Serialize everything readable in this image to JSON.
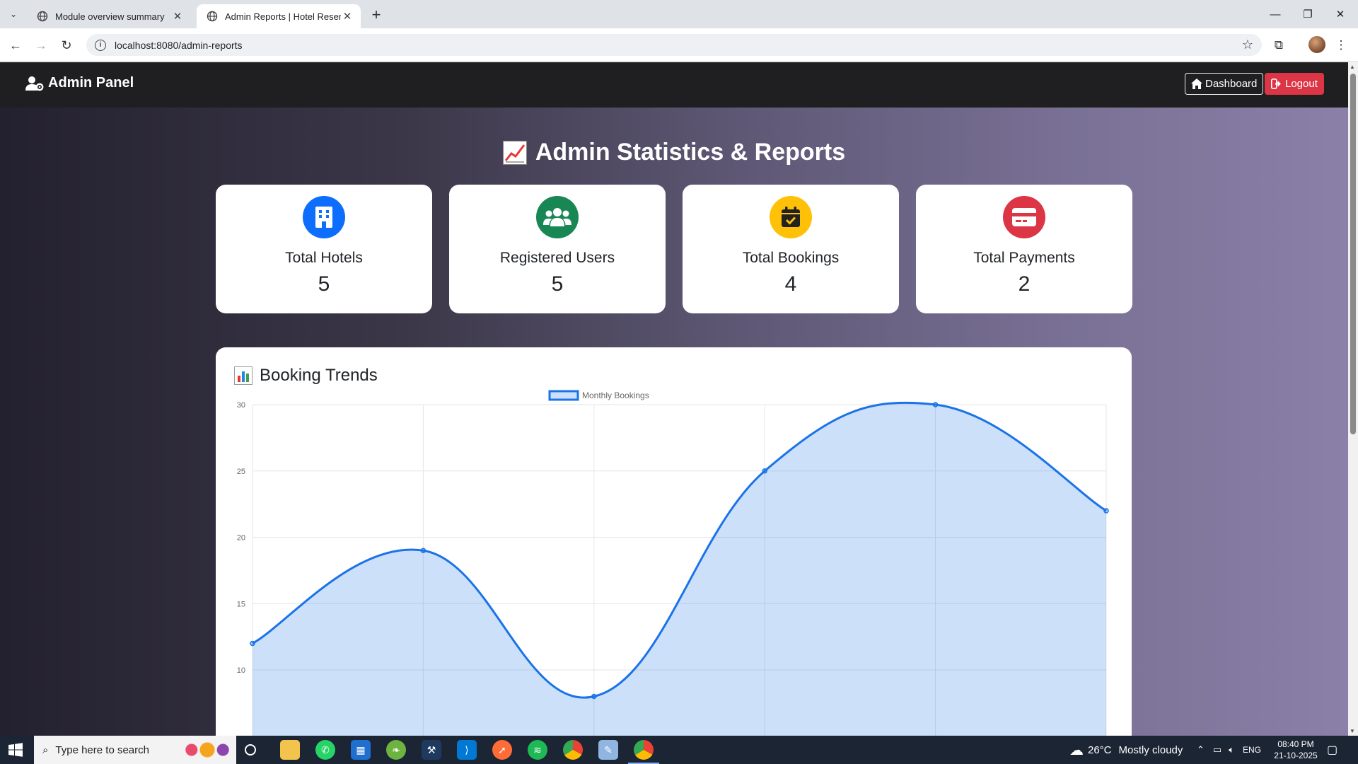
{
  "browser": {
    "tabs": [
      {
        "title": "Module overview summary",
        "active": false
      },
      {
        "title": "Admin Reports | Hotel Reservati",
        "active": true
      }
    ],
    "url": "localhost:8080/admin-reports"
  },
  "navbar": {
    "brand": "Admin Panel",
    "dashboard_label": "Dashboard",
    "logout_label": "Logout"
  },
  "page": {
    "heading": "Admin Statistics & Reports"
  },
  "stats": [
    {
      "label": "Total Hotels",
      "value": "5",
      "icon": "building-icon",
      "color": "#0d6efd"
    },
    {
      "label": "Registered Users",
      "value": "5",
      "icon": "users-icon",
      "color": "#198754"
    },
    {
      "label": "Total Bookings",
      "value": "4",
      "icon": "calendar-check-icon",
      "color": "#ffc107"
    },
    {
      "label": "Total Payments",
      "value": "2",
      "icon": "credit-card-icon",
      "color": "#dc3545"
    }
  ],
  "chart_card": {
    "title": "Booking Trends"
  },
  "chart_data": {
    "type": "area",
    "series": [
      {
        "name": "Monthly Bookings",
        "values": [
          12,
          19,
          8,
          25,
          30,
          22
        ],
        "color": "#1a73e8"
      }
    ],
    "ylim": [
      10,
      30
    ],
    "yticks": [
      30,
      25,
      20,
      15,
      10
    ],
    "grid": true,
    "legend": "top-center",
    "curve": "smooth"
  },
  "taskbar": {
    "search_placeholder": "Type here to search",
    "weather_temp": "26°C",
    "weather_text": "Mostly cloudy",
    "language": "ENG",
    "time": "08:40 PM",
    "date": "21-10-2025"
  }
}
